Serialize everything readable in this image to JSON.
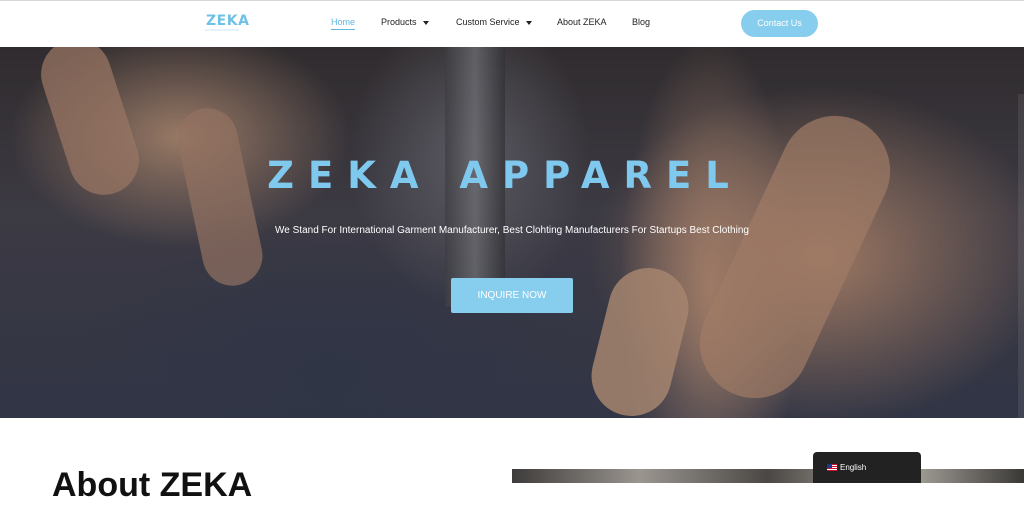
{
  "header": {
    "logo": "ZEKA",
    "nav": {
      "home": "Home",
      "products": "Products",
      "custom_service": "Custom Service",
      "about": "About ZEKA",
      "blog": "Blog"
    },
    "contact_label": "Contact Us"
  },
  "hero": {
    "title": "ZEKA APPAREL",
    "subtitle": "We Stand For International Garment Manufacturer, Best Clohting Manufacturers For Startups Best Clothing",
    "cta_label": "INQUIRE NOW"
  },
  "about": {
    "heading": "About ZEKA"
  },
  "language_switcher": {
    "label": "English",
    "flag_icon": "us-flag-icon"
  },
  "colors": {
    "accent": "#86cdee",
    "title": "#7fc8ee",
    "nav_active": "#5fb6e0"
  }
}
